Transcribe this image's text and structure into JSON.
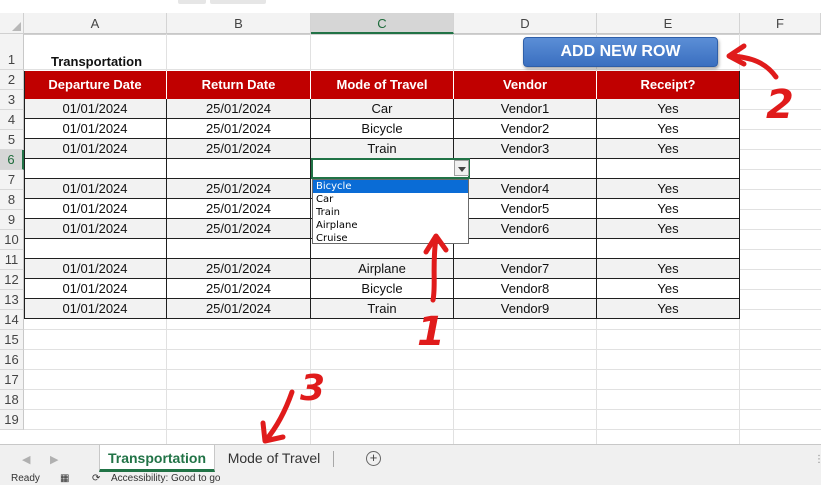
{
  "columns": [
    "A",
    "B",
    "C",
    "D",
    "E",
    "F"
  ],
  "rows": [
    "1",
    "2",
    "3",
    "4",
    "5",
    "6",
    "7",
    "8",
    "9",
    "10",
    "11",
    "12",
    "13",
    "14",
    "15",
    "16",
    "17",
    "18",
    "19"
  ],
  "sheet_title": "Transportation",
  "add_row_button": "ADD NEW ROW",
  "table_headers": [
    "Departure Date",
    "Return Date",
    "Mode of Travel",
    "Vendor",
    "Receipt?"
  ],
  "table_rows": [
    [
      "01/01/2024",
      "25/01/2024",
      "Car",
      "Vendor1",
      "Yes"
    ],
    [
      "01/01/2024",
      "25/01/2024",
      "Bicycle",
      "Vendor2",
      "Yes"
    ],
    [
      "01/01/2024",
      "25/01/2024",
      "Train",
      "Vendor3",
      "Yes"
    ],
    [
      "",
      "",
      "",
      "",
      ""
    ],
    [
      "01/01/2024",
      "25/01/2024",
      "",
      "Vendor4",
      "Yes"
    ],
    [
      "01/01/2024",
      "25/01/2024",
      "",
      "Vendor5",
      "Yes"
    ],
    [
      "01/01/2024",
      "25/01/2024",
      "",
      "Vendor6",
      "Yes"
    ],
    [
      "",
      "",
      "",
      "",
      ""
    ],
    [
      "01/01/2024",
      "25/01/2024",
      "Airplane",
      "Vendor7",
      "Yes"
    ],
    [
      "01/01/2024",
      "25/01/2024",
      "Bicycle",
      "Vendor8",
      "Yes"
    ],
    [
      "01/01/2024",
      "25/01/2024",
      "Train",
      "Vendor9",
      "Yes"
    ]
  ],
  "dropdown_options": [
    "Bicycle",
    "Car",
    "Train",
    "Airplane",
    "Cruise"
  ],
  "dropdown_selected": "Bicycle",
  "sheet_tabs": [
    "Transportation",
    "Mode of Travel"
  ],
  "active_tab": "Transportation",
  "status": {
    "ready": "Ready",
    "accessibility": "Accessibility: Good to go"
  },
  "annotations": [
    "1",
    "2",
    "3"
  ],
  "colors": {
    "header_fill": "#c00000",
    "button_fill": "#4472c4",
    "annotation_red": "#e01b1b",
    "excel_green": "#217346"
  }
}
